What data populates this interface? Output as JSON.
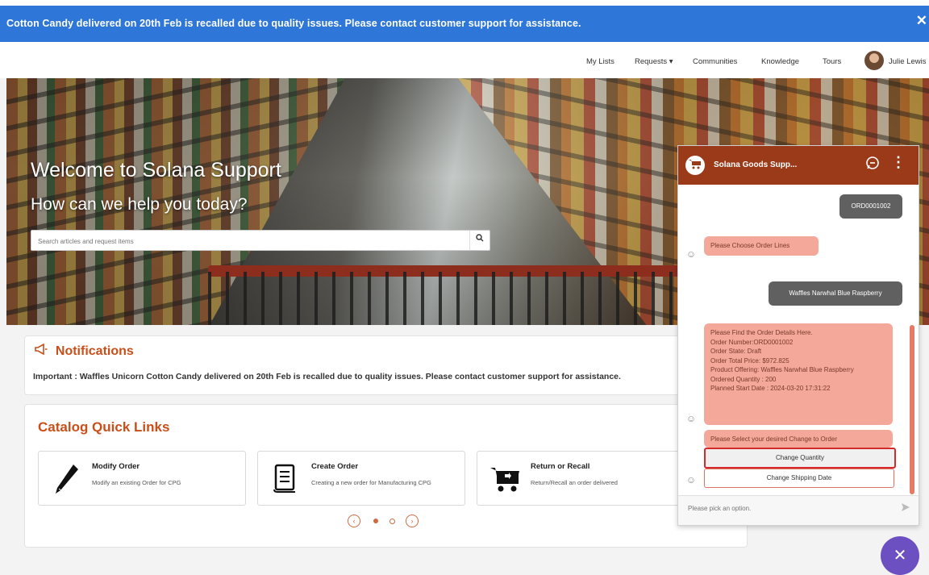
{
  "banner": {
    "text": "Cotton Candy delivered on 20th Feb is recalled due to quality issues. Please contact customer support for assistance.",
    "close": "✕"
  },
  "nav": {
    "items": [
      "My Lists",
      "Requests ▾",
      "Communities",
      "Knowledge",
      "Tours"
    ],
    "user": "Julie Lewis"
  },
  "hero": {
    "title": "Welcome to Solana Support",
    "subtitle": "How can we help you today?",
    "search_placeholder": "Search articles and request items",
    "search_icon": "🔍"
  },
  "notifications": {
    "title": "Notifications",
    "icon": "megaphone-icon",
    "text": "Important : Waffles Unicorn Cotton Candy delivered on 20th Feb is recalled due to quality issues. Please contact customer support for assistance."
  },
  "catalog": {
    "title": "Catalog Quick Links",
    "tiles": [
      {
        "title": "Modify Order",
        "desc": "Modify an existing Order for CPG",
        "icon": "pen-icon"
      },
      {
        "title": "Create Order",
        "desc": "Creating a new order for Manufacturing CPG",
        "icon": "document-icon"
      },
      {
        "title": "Return or Recall",
        "desc": "Return/Recall an order delivered",
        "icon": "cart-return-icon"
      }
    ],
    "pager": {
      "prev": "‹",
      "next": "›",
      "current_page": 1,
      "pages": 2
    }
  },
  "chat": {
    "title": "Solana Goods Supp...",
    "messages": {
      "m1": "ORD0001002",
      "m2": "Please Choose Order Lines",
      "m3": "Waffles Narwhal Blue Raspberry",
      "m4_lines": [
        "Please Find the Order Details Here.",
        "Order Number:ORD0001002",
        "Order State: Draft",
        "Order Total Price: $972.825",
        "Product Offering: Waffles Narwhal Blue Raspberry",
        "Ordered Quantity : 200",
        "Planned Start Date : 2024-03-20 17:31:22"
      ],
      "m5": "Please Select your desired Change to Order"
    },
    "options": [
      "Change Quantity",
      "Change Shipping Date"
    ],
    "input_placeholder": "Please pick an option.",
    "send_icon": "send-icon"
  },
  "fab": {
    "label": "✕"
  },
  "colors": {
    "banner": "#2e77d8",
    "accent": "#c84f1a",
    "chat_header": "#9a3a18",
    "bot_bubble": "#f3a89a",
    "user_bubble": "#606060",
    "fab": "#6c4fc1"
  }
}
